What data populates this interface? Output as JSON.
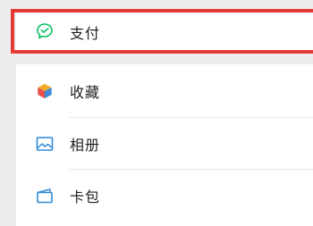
{
  "payment": {
    "label": "支付",
    "icon": "payment-check-icon",
    "icon_color": "#07c160",
    "highlight_color": "#e53935"
  },
  "items": [
    {
      "label": "收藏",
      "icon": "favorites-cube-icon"
    },
    {
      "label": "相册",
      "icon": "album-picture-icon",
      "icon_color": "#2f8ad8"
    },
    {
      "label": "卡包",
      "icon": "card-wallet-icon",
      "icon_color": "#2f8ad8"
    }
  ]
}
